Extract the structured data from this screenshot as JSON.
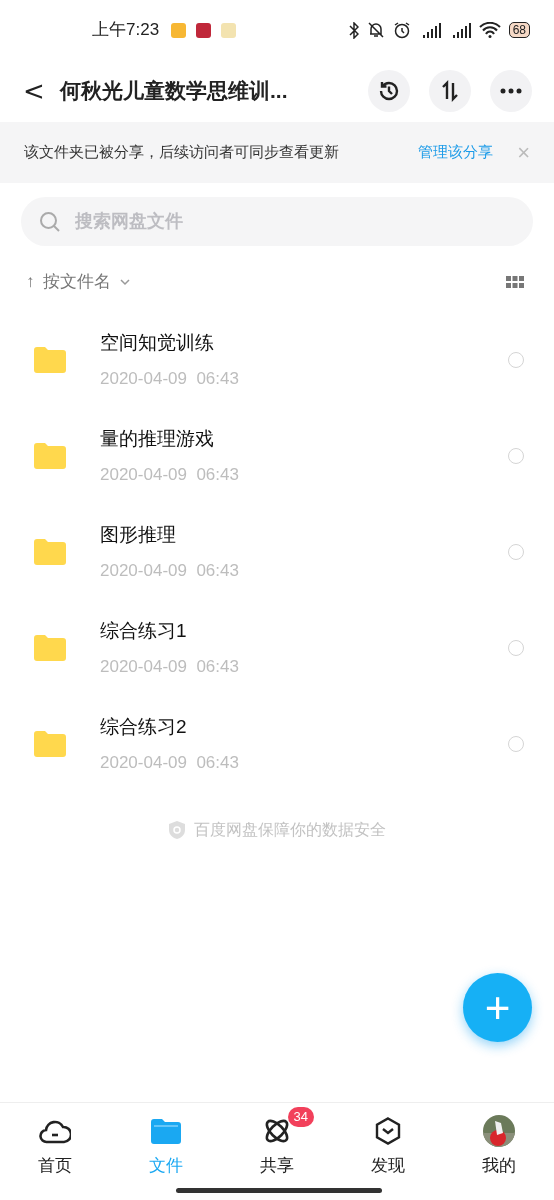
{
  "status_bar": {
    "time": "上午7:23",
    "battery": "68"
  },
  "header": {
    "back": "<",
    "title": "何秋光儿童数学思维训..."
  },
  "share_banner": {
    "text": "该文件夹已被分享，后续访问者可同步查看更新",
    "action": "管理该分享",
    "close": "×"
  },
  "search": {
    "placeholder": "搜索网盘文件"
  },
  "sort": {
    "arrow": "↑",
    "label": "按文件名"
  },
  "files": [
    {
      "name": "空间知觉训练",
      "date": "2020-04-09  06:43",
      "checked": false
    },
    {
      "name": "量的推理游戏",
      "date": "2020-04-09  06:43",
      "checked": false
    },
    {
      "name": "图形推理",
      "date": "2020-04-09  06:43",
      "checked": false
    },
    {
      "name": "综合练习1",
      "date": "2020-04-09  06:43",
      "checked": false
    },
    {
      "name": "综合练习2",
      "date": "2020-04-09  06:43",
      "checked": false
    }
  ],
  "footer_note": "百度网盘保障你的数据安全",
  "fab": "+",
  "bottom_nav": [
    {
      "kind": "home",
      "label": "首页",
      "selected": false
    },
    {
      "kind": "files",
      "label": "文件",
      "selected": true
    },
    {
      "kind": "share",
      "label": "共享",
      "selected": false,
      "badge": "34"
    },
    {
      "kind": "discover",
      "label": "发现",
      "selected": false
    },
    {
      "kind": "me",
      "label": "我的",
      "selected": false
    }
  ]
}
